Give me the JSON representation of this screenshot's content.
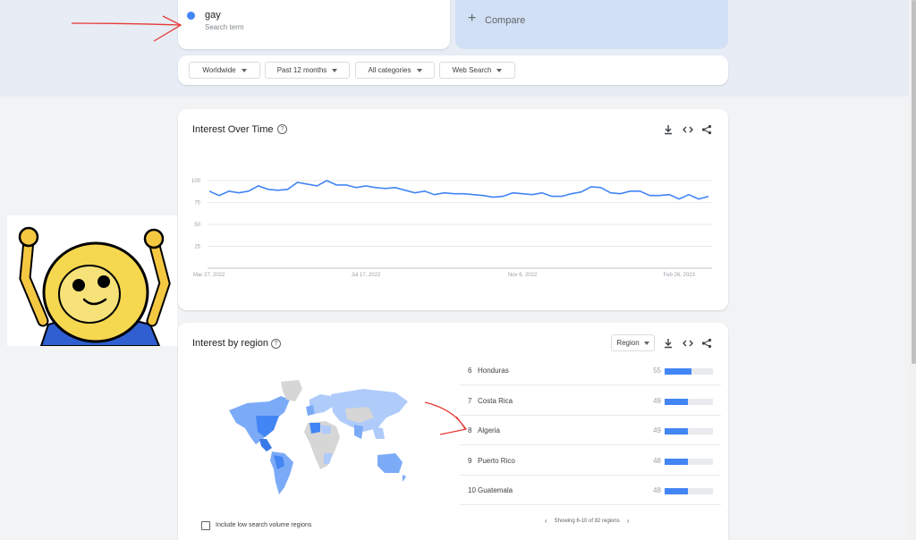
{
  "search_term": {
    "name": "gay",
    "sub": "Search term"
  },
  "compare": {
    "plus": "+",
    "label": "Compare"
  },
  "filters": [
    "Worldwide",
    "Past 12 months",
    "All categories",
    "Web Search"
  ],
  "interest_over_time": {
    "title": "Interest Over Time",
    "help": "?"
  },
  "chart_data": {
    "type": "line",
    "title": "Interest Over Time",
    "xlabel": "",
    "ylabel": "",
    "ylim": [
      0,
      100
    ],
    "yticks": [
      "100",
      "75",
      "50",
      "25"
    ],
    "x_tick_labels": [
      "Mar 27, 2022",
      "Jul 17, 2022",
      "Nov 6, 2022",
      "Feb 26, 2023"
    ],
    "x": [
      "2022-03-27",
      "2022-04-03",
      "2022-04-10",
      "2022-04-17",
      "2022-04-24",
      "2022-05-01",
      "2022-05-08",
      "2022-05-15",
      "2022-05-22",
      "2022-05-29",
      "2022-06-05",
      "2022-06-12",
      "2022-06-19",
      "2022-06-26",
      "2022-07-03",
      "2022-07-10",
      "2022-07-17",
      "2022-07-24",
      "2022-07-31",
      "2022-08-07",
      "2022-08-14",
      "2022-08-21",
      "2022-08-28",
      "2022-09-04",
      "2022-09-11",
      "2022-09-18",
      "2022-09-25",
      "2022-10-02",
      "2022-10-09",
      "2022-10-16",
      "2022-10-23",
      "2022-10-30",
      "2022-11-06",
      "2022-11-13",
      "2022-11-20",
      "2022-11-27",
      "2022-12-04",
      "2022-12-11",
      "2022-12-18",
      "2022-12-25",
      "2023-01-01",
      "2023-01-08",
      "2023-01-15",
      "2023-01-22",
      "2023-01-29",
      "2023-02-05",
      "2023-02-12",
      "2023-02-19",
      "2023-02-26",
      "2023-03-05",
      "2023-03-12",
      "2023-03-19"
    ],
    "values": [
      88,
      83,
      88,
      86,
      88,
      94,
      90,
      89,
      90,
      98,
      96,
      94,
      100,
      95,
      95,
      92,
      94,
      92,
      91,
      92,
      89,
      86,
      88,
      84,
      86,
      85,
      85,
      84,
      83,
      81,
      82,
      86,
      85,
      84,
      86,
      82,
      82,
      85,
      87,
      93,
      92,
      86,
      85,
      88,
      88,
      83,
      83,
      84,
      79,
      84,
      79,
      82
    ]
  },
  "interest_by_region": {
    "title": "Interest by region",
    "help": "?",
    "select": "Region",
    "rows": [
      {
        "rank": "6",
        "name": "Honduras",
        "value": 55
      },
      {
        "rank": "7",
        "name": "Costa Rica",
        "value": 49
      },
      {
        "rank": "8",
        "name": "Algeria",
        "value": 49
      },
      {
        "rank": "9",
        "name": "Puerto Rico",
        "value": 48
      },
      {
        "rank": "10",
        "name": "Guatemala",
        "value": 48
      }
    ],
    "pager_text": "Showing 6-10 of 82 regions",
    "checkbox_label": "Include low search volume regions"
  },
  "colors": {
    "line": "#4285f4",
    "annotation": "#e53935"
  }
}
